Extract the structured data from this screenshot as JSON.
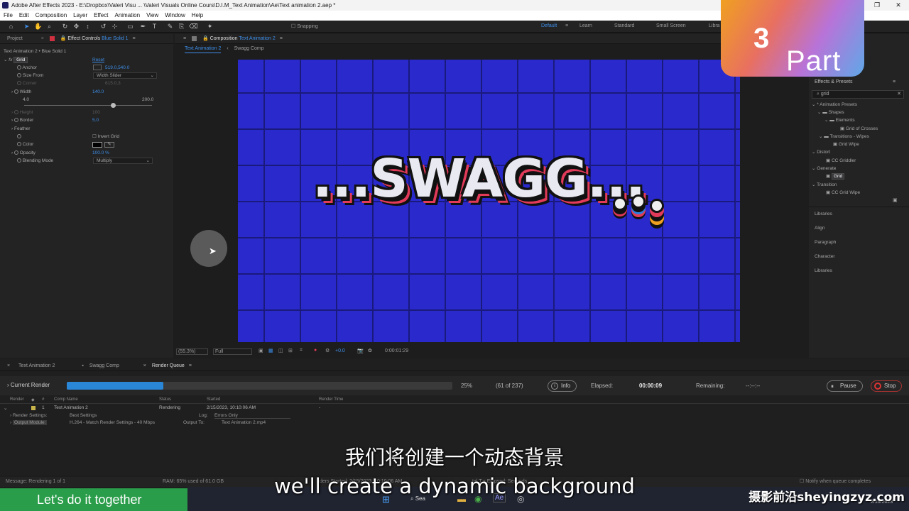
{
  "window": {
    "title": "Adobe After Effects 2023 - E:\\Dropbox\\Valeri Visu ... \\Valeri Visuals Online Cours\\D.I.M_Text Animation\\Ae\\Text animation 2.aep *",
    "minimize": "—",
    "maximize": "❐",
    "close": "✕"
  },
  "menu": [
    "File",
    "Edit",
    "Composition",
    "Layer",
    "Effect",
    "Animation",
    "View",
    "Window",
    "Help"
  ],
  "toolbar": {
    "snapping": "Snapping",
    "workspaces": [
      "Default",
      "Learn",
      "Standard",
      "Small Screen",
      "Libra"
    ]
  },
  "left_panel": {
    "tab_project": "Project",
    "tab_effect_controls": "Effect Controls",
    "effect_target": "Blue Solid 1",
    "layer_path": "Text Animation 2 • Blue Solid 1",
    "effect_name": "Grid",
    "reset": "Reset",
    "props": [
      {
        "label": "Anchor",
        "value": "519.0,540.0"
      },
      {
        "label": "Size From",
        "value": "Width Slider"
      },
      {
        "label": "Corner",
        "value": "615.0,3 "
      },
      {
        "label": "Width",
        "value": "140.0"
      },
      {
        "label": "slider_min",
        "value": "4.0"
      },
      {
        "label": "slider_max",
        "value": "200.0"
      },
      {
        "label": "Height",
        "value": "100"
      },
      {
        "label": "Border",
        "value": "5.0"
      },
      {
        "label": "Feather",
        "value": ""
      },
      {
        "label": "Invert Grid",
        "value": ""
      },
      {
        "label": "Color",
        "value": ""
      },
      {
        "label": "Opacity",
        "value": "100.0 %"
      },
      {
        "label": "Blending Mode",
        "value": "Multiply"
      }
    ]
  },
  "viewer": {
    "tab_label": "Composition",
    "comp_name": "Text Animation 2",
    "subtabs": [
      "Text Animation 2",
      "Swagg Comp"
    ],
    "zoom": "(55.3%)",
    "resolution": "Full",
    "exposure": "+0.0",
    "timecode": "0:00:01:29",
    "text": "...SWAGG..."
  },
  "right_panel": {
    "title": "Effects & Presets",
    "search": "grid",
    "tree": [
      "* Animation Presets",
      "Shapes",
      "Elements",
      "Grid of Crosses",
      "Transitions - Wipes",
      "Grid Wipe",
      "Distort",
      "CC Griddler",
      "Generate",
      "Grid",
      "Transition",
      "CC Grid Wipe"
    ],
    "sections": [
      "Libraries",
      "Align",
      "Paragraph",
      "Character",
      "Libraries"
    ]
  },
  "bottom": {
    "tabs": [
      "Text Animation 2",
      "Swagg Comp",
      "Render Queue"
    ],
    "current_render": "Current Render",
    "percent": "25%",
    "progress_value": 0.25,
    "frames": "(61 of 237)",
    "info": "Info",
    "elapsed_label": "Elapsed:",
    "elapsed": "00:00:09",
    "remaining_label": "Remaining:",
    "remaining": "--:--:--",
    "pause": "Pause",
    "stop": "Stop",
    "columns": [
      "Render",
      "#",
      "Comp Name",
      "Status",
      "Started",
      "Render Time"
    ],
    "row": {
      "num": "1",
      "comp": "Text Animation 2",
      "status": "Rendering",
      "started": "2/15/2023, 10:10:06 AM",
      "render_time": "-"
    },
    "render_settings_label": "Render Settings:",
    "render_settings": "Best Settings",
    "log_label": "Log:",
    "log": "Errors Only",
    "output_module_label": "Output Module:",
    "output_module": "H.264 - Match Render Settings - 40 Mbps",
    "output_to_label": "Output To:",
    "output_to": "Text Animation 2.mp4"
  },
  "status": {
    "message": "Message:  Rendering 1 of 1",
    "ram": "RAM:  65% used of 61.0 GB",
    "renders_started": "ders Started:  2/15/2023, 10:10:06 AM",
    "total_elapsed": "tal T     s Elapsed:   Seconds",
    "notify": "Notify when queue completes"
  },
  "overlay": {
    "part_label": "Part",
    "part_number": "3",
    "subtitle_cn": "我们将创建一个动态背景",
    "subtitle_en": "we'll create a dynamic background",
    "green_banner": "Let's do it together",
    "watermark": "摄影前沿sheyingzyz.com",
    "taskbar_search": "Sea",
    "clock_date": "2/15/2023"
  }
}
